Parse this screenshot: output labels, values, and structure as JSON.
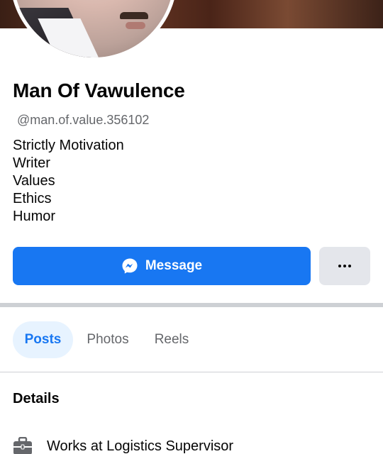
{
  "profile": {
    "name": "Man Of Vawulence",
    "handle": "@man.of.value.356102",
    "bio": [
      "Strictly Motivation",
      "Writer",
      "Values",
      "Ethics",
      "Humor"
    ]
  },
  "actions": {
    "message_label": "Message",
    "message_icon": "messenger-icon",
    "more_icon": "more-dots-icon"
  },
  "tabs": [
    {
      "label": "Posts",
      "active": true
    },
    {
      "label": "Photos",
      "active": false
    },
    {
      "label": "Reels",
      "active": false
    }
  ],
  "details": {
    "heading": "Details",
    "items": [
      {
        "icon": "briefcase-icon",
        "text": "Works at Logistics Supervisor"
      }
    ]
  },
  "colors": {
    "accent": "#1877f2",
    "active_tab_bg": "#e7f3ff",
    "secondary_button_bg": "#e4e6eb",
    "muted_text": "#65676b"
  }
}
